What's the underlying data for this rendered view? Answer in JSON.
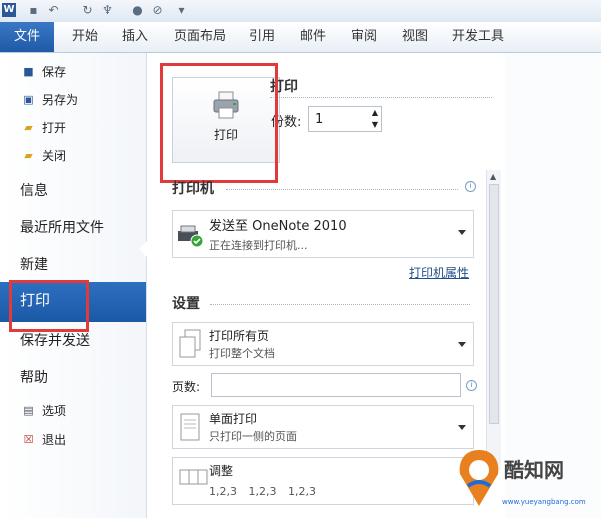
{
  "app": {
    "logo_letter": "W"
  },
  "tabs": {
    "file": "文件",
    "items": [
      "开始",
      "插入",
      "页面布局",
      "引用",
      "邮件",
      "审阅",
      "视图",
      "开发工具"
    ]
  },
  "nav": {
    "save": "保存",
    "save_as": "另存为",
    "open": "打开",
    "close": "关闭",
    "info": "信息",
    "recent": "最近所用文件",
    "new": "新建",
    "print": "打印",
    "save_send": "保存并发送",
    "help": "帮助",
    "options": "选项",
    "exit": "退出"
  },
  "print_section": {
    "heading": "打印",
    "button_label": "打印",
    "copies_label": "份数:",
    "copies_value": "1"
  },
  "printer": {
    "heading": "打印机",
    "name": "发送至 OneNote 2010",
    "status": "正在连接到打印机...",
    "properties_link": "打印机属性"
  },
  "settings": {
    "heading": "设置",
    "print_range_title": "打印所有页",
    "print_range_sub": "打印整个文档",
    "pages_label": "页数:",
    "pages_value": "",
    "sides_title": "单面打印",
    "sides_sub": "只打印一侧的页面",
    "collate_title": "调整",
    "collate_sub": "1,2,3    1,2,3    1,2,3"
  },
  "watermark": {
    "text": "酷知网",
    "sub": "www.yueyangbang.com"
  },
  "colors": {
    "accent": "#1f5aa8",
    "highlight": "#e23a3a"
  }
}
